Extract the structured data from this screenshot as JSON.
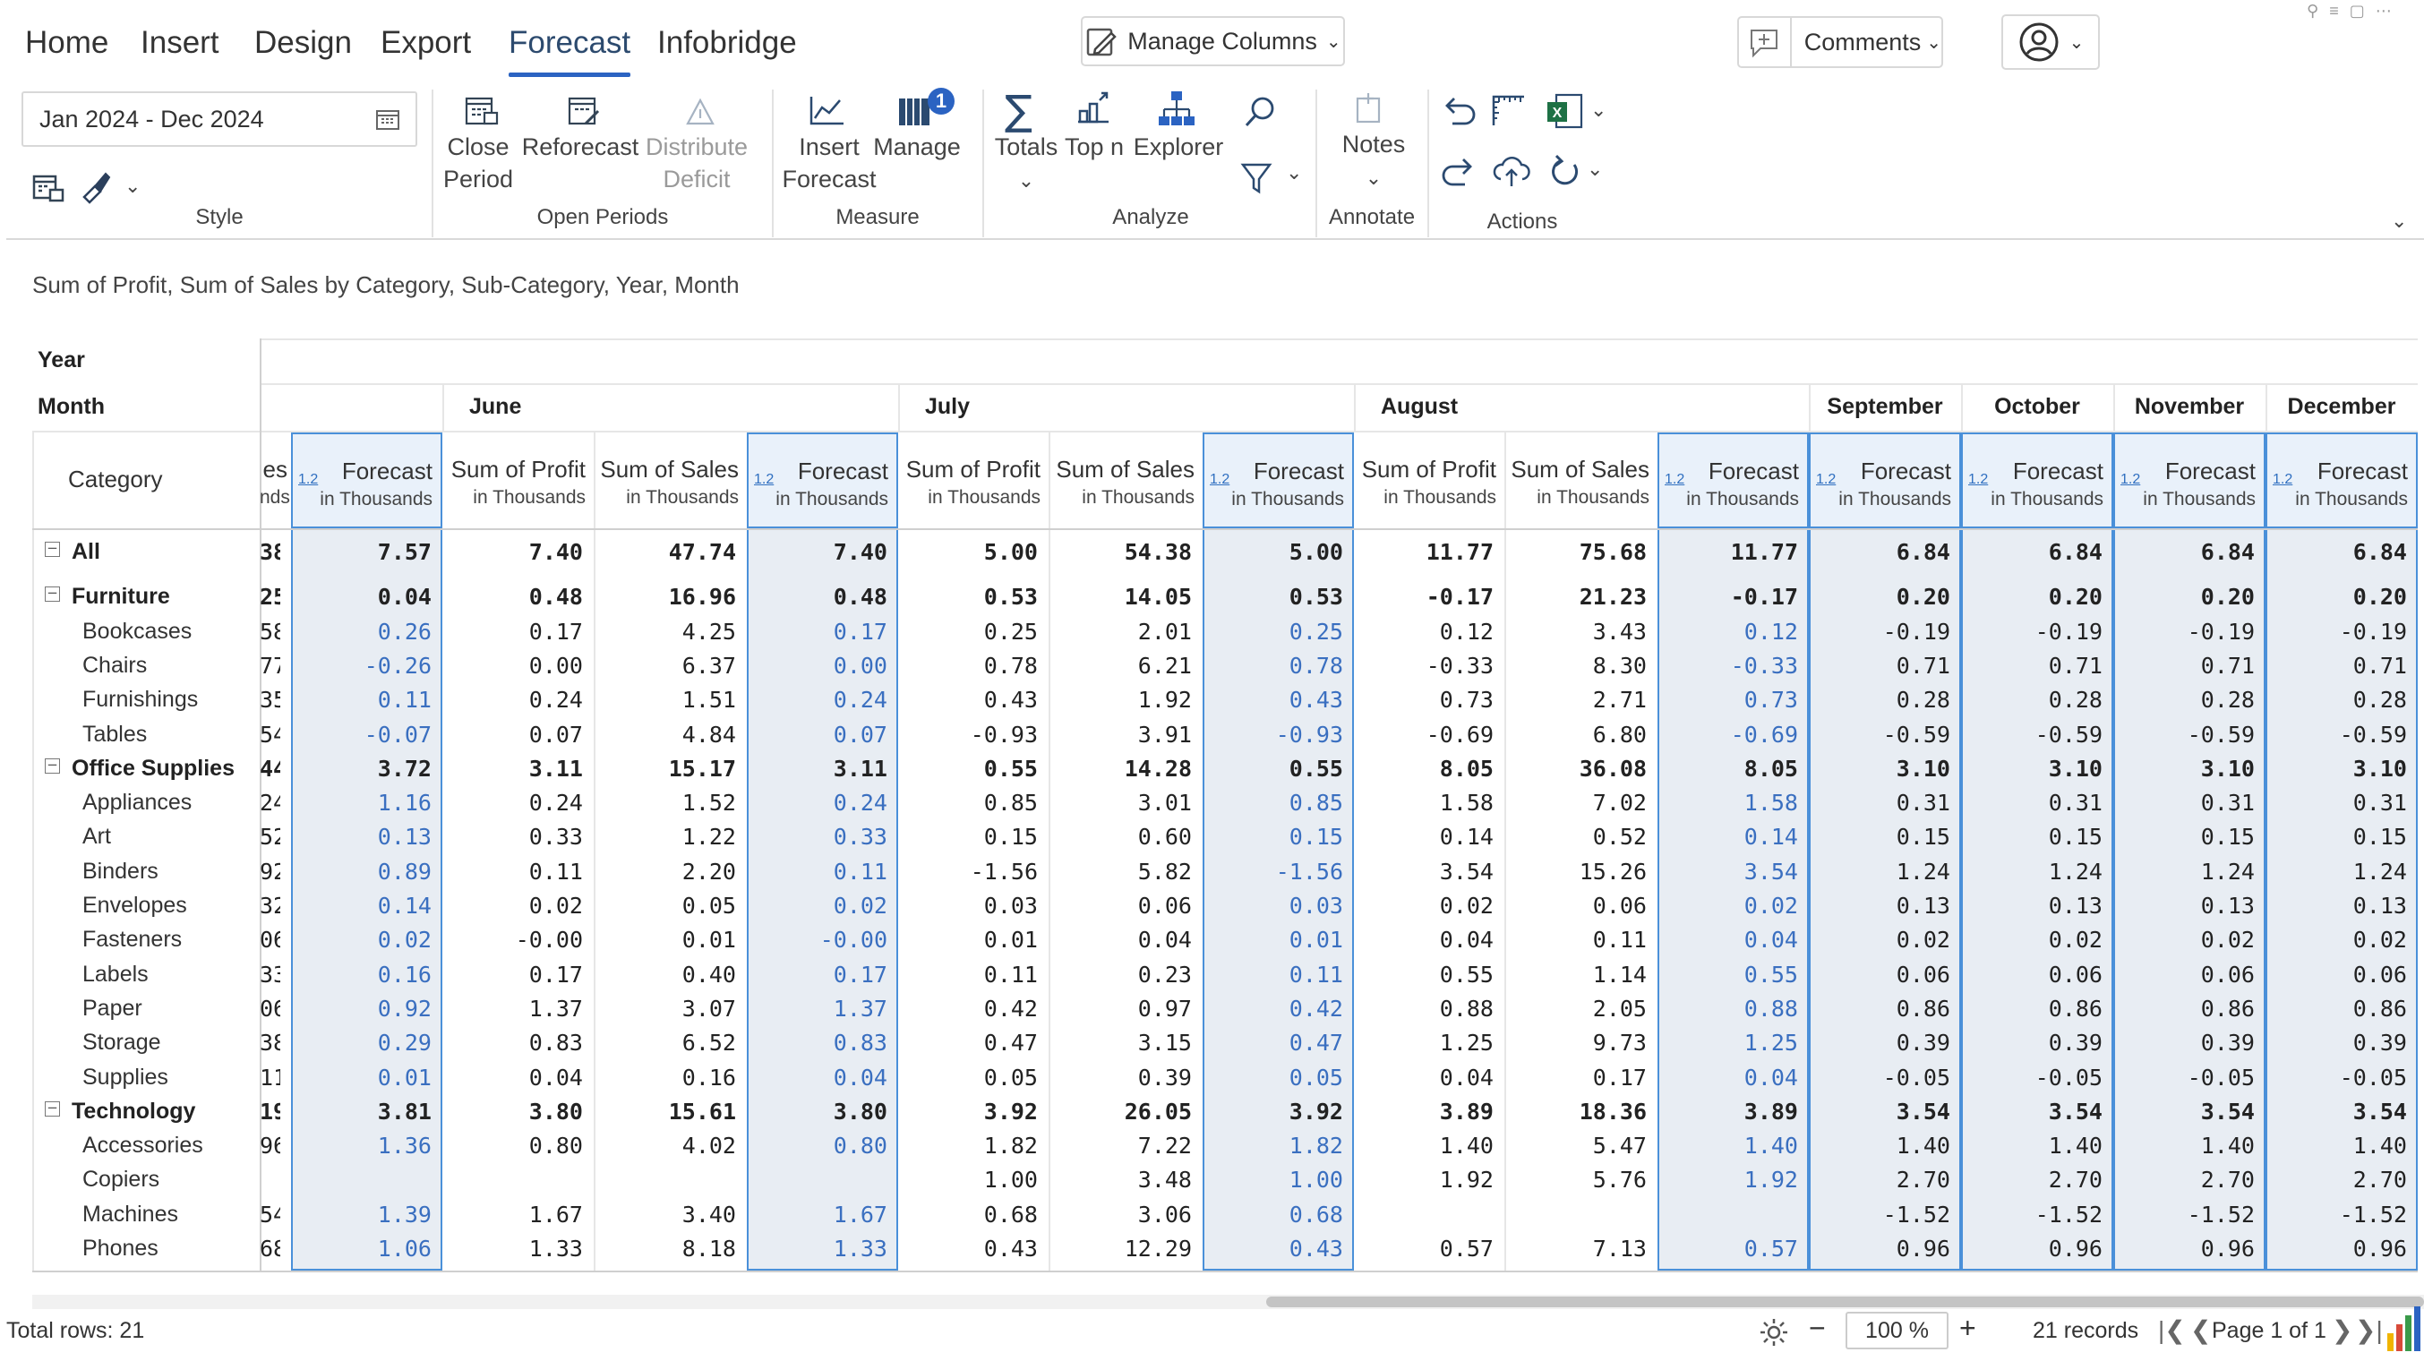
{
  "tabs": [
    "Home",
    "Insert",
    "Design",
    "Export",
    "Forecast",
    "Infobridge"
  ],
  "active_tab": "Forecast",
  "top_bar": {
    "manage_columns": "Manage Columns",
    "comments": "Comments"
  },
  "style_group": {
    "date_range": "Jan 2024 - Dec 2024",
    "label": "Style"
  },
  "open_periods": {
    "label": "Open Periods",
    "close_period": [
      "Close",
      "Period"
    ],
    "reforecast": "Reforecast",
    "distribute_deficit": [
      "Distribute",
      "Deficit"
    ]
  },
  "measure": {
    "label": "Measure",
    "insert_forecast": [
      "Insert",
      "Forecast"
    ],
    "manage": "Manage",
    "manage_badge": "1"
  },
  "analyze": {
    "label": "Analyze",
    "totals": "Totals",
    "top_n": "Top n",
    "explorer": "Explorer"
  },
  "annotate": {
    "label": "Annotate",
    "notes": "Notes"
  },
  "actions": {
    "label": "Actions"
  },
  "grid": {
    "subtitle": "Sum of Profit, Sum of Sales by Category, Sub-Category, Year, Month",
    "year_label": "Year",
    "month_label": "Month",
    "category_label": "Category",
    "partial_header": [
      "es",
      "nds"
    ],
    "months": [
      "June",
      "July",
      "August",
      "September",
      "October",
      "November",
      "December"
    ],
    "col_profit": "Sum of Profit",
    "col_sales": "Sum of Sales",
    "col_forecast": "Forecast",
    "unit": "in Thousands",
    "badge": "1.2",
    "rows": [
      {
        "label": "All",
        "level": 0,
        "bold": true,
        "cells": [
          "38",
          "7.57",
          "7.40",
          "47.74",
          "7.40",
          "5.00",
          "54.38",
          "5.00",
          "11.77",
          "75.68",
          "11.77",
          "6.84",
          "6.84",
          "6.84",
          "6.84"
        ]
      },
      {
        "label": "Furniture",
        "level": 1,
        "bold": true,
        "cells": [
          "25",
          "0.04",
          "0.48",
          "16.96",
          "0.48",
          "0.53",
          "14.05",
          "0.53",
          "-0.17",
          "21.23",
          "-0.17",
          "0.20",
          "0.20",
          "0.20",
          "0.20"
        ]
      },
      {
        "label": "Bookcases",
        "level": 2,
        "cells": [
          "58",
          "0.26",
          "0.17",
          "4.25",
          "0.17",
          "0.25",
          "2.01",
          "0.25",
          "0.12",
          "3.43",
          "0.12",
          "-0.19",
          "-0.19",
          "-0.19",
          "-0.19"
        ]
      },
      {
        "label": "Chairs",
        "level": 2,
        "cells": [
          "77",
          "-0.26",
          "0.00",
          "6.37",
          "0.00",
          "0.78",
          "6.21",
          "0.78",
          "-0.33",
          "8.30",
          "-0.33",
          "0.71",
          "0.71",
          "0.71",
          "0.71"
        ]
      },
      {
        "label": "Furnishings",
        "level": 2,
        "cells": [
          "35",
          "0.11",
          "0.24",
          "1.51",
          "0.24",
          "0.43",
          "1.92",
          "0.43",
          "0.73",
          "2.71",
          "0.73",
          "0.28",
          "0.28",
          "0.28",
          "0.28"
        ]
      },
      {
        "label": "Tables",
        "level": 2,
        "cells": [
          "54",
          "-0.07",
          "0.07",
          "4.84",
          "0.07",
          "-0.93",
          "3.91",
          "-0.93",
          "-0.69",
          "6.80",
          "-0.69",
          "-0.59",
          "-0.59",
          "-0.59",
          "-0.59"
        ]
      },
      {
        "label": "Office Supplies",
        "level": 1,
        "bold": true,
        "cells": [
          "44",
          "3.72",
          "3.11",
          "15.17",
          "3.11",
          "0.55",
          "14.28",
          "0.55",
          "8.05",
          "36.08",
          "8.05",
          "3.10",
          "3.10",
          "3.10",
          "3.10"
        ]
      },
      {
        "label": "Appliances",
        "level": 2,
        "cells": [
          "24",
          "1.16",
          "0.24",
          "1.52",
          "0.24",
          "0.85",
          "3.01",
          "0.85",
          "1.58",
          "7.02",
          "1.58",
          "0.31",
          "0.31",
          "0.31",
          "0.31"
        ]
      },
      {
        "label": "Art",
        "level": 2,
        "cells": [
          "52",
          "0.13",
          "0.33",
          "1.22",
          "0.33",
          "0.15",
          "0.60",
          "0.15",
          "0.14",
          "0.52",
          "0.14",
          "0.15",
          "0.15",
          "0.15",
          "0.15"
        ]
      },
      {
        "label": "Binders",
        "level": 2,
        "cells": [
          "92",
          "0.89",
          "0.11",
          "2.20",
          "0.11",
          "-1.56",
          "5.82",
          "-1.56",
          "3.54",
          "15.26",
          "3.54",
          "1.24",
          "1.24",
          "1.24",
          "1.24"
        ]
      },
      {
        "label": "Envelopes",
        "level": 2,
        "cells": [
          "32",
          "0.14",
          "0.02",
          "0.05",
          "0.02",
          "0.03",
          "0.06",
          "0.03",
          "0.02",
          "0.06",
          "0.02",
          "0.13",
          "0.13",
          "0.13",
          "0.13"
        ]
      },
      {
        "label": "Fasteners",
        "level": 2,
        "cells": [
          "06",
          "0.02",
          "-0.00",
          "0.01",
          "-0.00",
          "0.01",
          "0.04",
          "0.01",
          "0.04",
          "0.11",
          "0.04",
          "0.02",
          "0.02",
          "0.02",
          "0.02"
        ]
      },
      {
        "label": "Labels",
        "level": 2,
        "cells": [
          "33",
          "0.16",
          "0.17",
          "0.40",
          "0.17",
          "0.11",
          "0.23",
          "0.11",
          "0.55",
          "1.14",
          "0.55",
          "0.06",
          "0.06",
          "0.06",
          "0.06"
        ]
      },
      {
        "label": "Paper",
        "level": 2,
        "cells": [
          "06",
          "0.92",
          "1.37",
          "3.07",
          "1.37",
          "0.42",
          "0.97",
          "0.42",
          "0.88",
          "2.05",
          "0.88",
          "0.86",
          "0.86",
          "0.86",
          "0.86"
        ]
      },
      {
        "label": "Storage",
        "level": 2,
        "cells": [
          "38",
          "0.29",
          "0.83",
          "6.52",
          "0.83",
          "0.47",
          "3.15",
          "0.47",
          "1.25",
          "9.73",
          "1.25",
          "0.39",
          "0.39",
          "0.39",
          "0.39"
        ]
      },
      {
        "label": "Supplies",
        "level": 2,
        "cells": [
          "11",
          "0.01",
          "0.04",
          "0.16",
          "0.04",
          "0.05",
          "0.39",
          "0.05",
          "0.04",
          "0.17",
          "0.04",
          "-0.05",
          "-0.05",
          "-0.05",
          "-0.05"
        ]
      },
      {
        "label": "Technology",
        "level": 1,
        "bold": true,
        "cells": [
          "19",
          "3.81",
          "3.80",
          "15.61",
          "3.80",
          "3.92",
          "26.05",
          "3.92",
          "3.89",
          "18.36",
          "3.89",
          "3.54",
          "3.54",
          "3.54",
          "3.54"
        ]
      },
      {
        "label": "Accessories",
        "level": 2,
        "cells": [
          "96",
          "1.36",
          "0.80",
          "4.02",
          "0.80",
          "1.82",
          "7.22",
          "1.82",
          "1.40",
          "5.47",
          "1.40",
          "1.40",
          "1.40",
          "1.40",
          "1.40"
        ]
      },
      {
        "label": "Copiers",
        "level": 2,
        "cells": [
          "",
          "",
          "",
          "",
          "",
          "1.00",
          "3.48",
          "1.00",
          "1.92",
          "5.76",
          "1.92",
          "2.70",
          "2.70",
          "2.70",
          "2.70"
        ]
      },
      {
        "label": "Machines",
        "level": 2,
        "cells": [
          "54",
          "1.39",
          "1.67",
          "3.40",
          "1.67",
          "0.68",
          "3.06",
          "0.68",
          "",
          "",
          "",
          "-1.52",
          "-1.52",
          "-1.52",
          "-1.52"
        ]
      },
      {
        "label": "Phones",
        "level": 2,
        "cells": [
          "68",
          "1.06",
          "1.33",
          "8.18",
          "1.33",
          "0.43",
          "12.29",
          "0.43",
          "0.57",
          "7.13",
          "0.57",
          "0.96",
          "0.96",
          "0.96",
          "0.96"
        ]
      }
    ]
  },
  "footer": {
    "total_rows": "Total rows: 21",
    "zoom": "100 %",
    "records": "21 records",
    "page": "Page 1 of 1"
  },
  "colors": {
    "accent": "#2b63c2",
    "forecast_border": "#4a90d9",
    "forecast_text": "#3a6fc0"
  }
}
